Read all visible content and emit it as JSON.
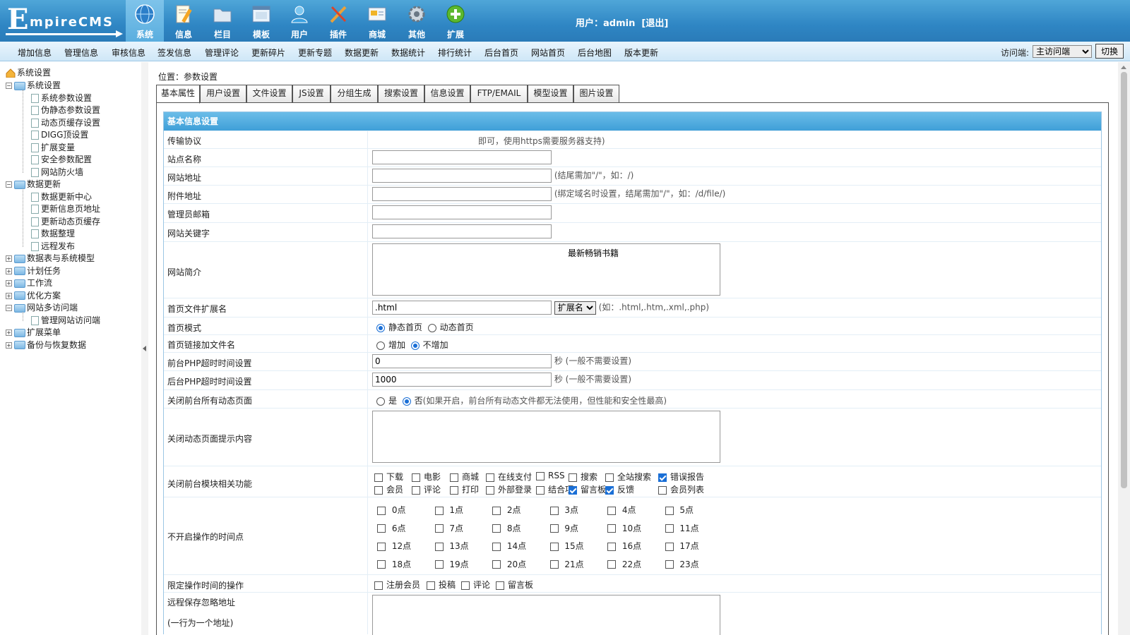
{
  "logo": {
    "first": "E",
    "rest": "mpireCMS"
  },
  "nav": [
    {
      "label": "系统",
      "icon": "globe-icon"
    },
    {
      "label": "信息",
      "icon": "document-edit-icon"
    },
    {
      "label": "栏目",
      "icon": "folder-icon"
    },
    {
      "label": "模板",
      "icon": "template-window-icon"
    },
    {
      "label": "用户",
      "icon": "user-icon"
    },
    {
      "label": "插件",
      "icon": "tools-icon"
    },
    {
      "label": "商城",
      "icon": "shop-icon"
    },
    {
      "label": "其他",
      "icon": "gear-icon"
    },
    {
      "label": "扩展",
      "icon": "plus-circle-icon"
    }
  ],
  "user": {
    "prefix": "用户：",
    "name": "admin",
    "logout": "[退出]"
  },
  "menu": [
    "增加信息",
    "管理信息",
    "审核信息",
    "签发信息",
    "管理评论",
    "更新碎片",
    "更新专题",
    "数据更新",
    "数据统计",
    "排行统计",
    "后台首页",
    "网站首页",
    "后台地图",
    "版本更新"
  ],
  "access": {
    "label": "访问端:",
    "selected": "主访问端",
    "switch_label": "切换"
  },
  "tree": {
    "root": "系统设置",
    "groups": [
      {
        "label": "系统设置",
        "items": [
          "系统参数设置",
          "伪静态参数设置",
          "动态页缓存设置",
          "DIGG顶设置",
          "扩展变量",
          "安全参数配置",
          "网站防火墙"
        ]
      },
      {
        "label": "数据更新",
        "items": [
          "数据更新中心",
          "更新信息页地址",
          "更新动态页缓存",
          "数据整理",
          "远程发布"
        ]
      },
      {
        "label": "数据表与系统模型",
        "items": []
      },
      {
        "label": "计划任务",
        "items": []
      },
      {
        "label": "工作流",
        "items": []
      },
      {
        "label": "优化方案",
        "items": []
      },
      {
        "label": "网站多访问端",
        "items": [
          "管理网站访问端"
        ]
      },
      {
        "label": "扩展菜单",
        "items": []
      },
      {
        "label": "备份与恢复数据",
        "items": []
      }
    ]
  },
  "breadcrumb": "位置：参数设置",
  "tabs": [
    "基本属性",
    "用户设置",
    "文件设置",
    "JS设置",
    "分组生成",
    "搜索设置",
    "信息设置",
    "FTP/EMAIL",
    "模型设置",
    "图片设置"
  ],
  "form": {
    "section_title": "基本信息设置",
    "protocol": {
      "label": "传输协议",
      "hint": "即可，使用https需要服务器支持)"
    },
    "site_name": {
      "label": "站点名称",
      "value": ""
    },
    "site_url": {
      "label": "网站地址",
      "value": "",
      "hint": "(结尾需加\"/\"，如：/)"
    },
    "attach_url": {
      "label": "附件地址",
      "value": "",
      "hint": "(绑定域名时设置，结尾需加\"/\"，如：/d/file/)"
    },
    "admin_email": {
      "label": "管理员邮箱",
      "value": ""
    },
    "keywords": {
      "label": "网站关键字",
      "value": ""
    },
    "intro": {
      "label": "网站简介",
      "value": "最新畅销书籍"
    },
    "index_ext": {
      "label": "首页文件扩展名",
      "value": ".html",
      "select": "扩展名",
      "hint": "(如：.html,.htm,.xml,.php)"
    },
    "index_mode": {
      "label": "首页模式",
      "opt1": "静态首页",
      "opt2": "动态首页"
    },
    "index_link": {
      "label": "首页链接加文件名",
      "opt1": "增加",
      "opt2": "不增加"
    },
    "front_timeout": {
      "label": "前台PHP超时时间设置",
      "value": "0",
      "hint": "秒 (一般不需要设置)"
    },
    "back_timeout": {
      "label": "后台PHP超时时间设置",
      "value": "1000",
      "hint": "秒 (一般不需要设置)"
    },
    "close_dynamic": {
      "label": "关闭前台所有动态页面",
      "opt1": "是",
      "opt2": "否",
      "hint": "(如果开启，前台所有动态文件都无法使用，但性能和安全性最高)"
    },
    "close_tip": {
      "label": "关闭动态页面提示内容",
      "value": ""
    },
    "close_modules": {
      "label": "关闭前台模块相关功能",
      "row1": [
        {
          "t": "下载",
          "on": false
        },
        {
          "t": "电影",
          "on": false
        },
        {
          "t": "商城",
          "on": false
        },
        {
          "t": "在线支付",
          "on": false
        },
        {
          "t": "RSS",
          "on": false
        },
        {
          "t": "搜索",
          "on": false
        },
        {
          "t": "全站搜索",
          "on": false
        },
        {
          "t": "错误报告",
          "on": true
        }
      ],
      "row2": [
        {
          "t": "会员",
          "on": false
        },
        {
          "t": "评论",
          "on": false
        },
        {
          "t": "打印",
          "on": false
        },
        {
          "t": "外部登录",
          "on": false
        },
        {
          "t": "结合项",
          "on": false
        },
        {
          "t": "留言板",
          "on": true
        },
        {
          "t": "反馈",
          "on": true
        },
        {
          "t": "会员列表",
          "on": false
        }
      ]
    },
    "hours": {
      "label": "不开启操作的时间点",
      "items": [
        "0点",
        "1点",
        "2点",
        "3点",
        "4点",
        "5点",
        "6点",
        "7点",
        "8点",
        "9点",
        "10点",
        "11点",
        "12点",
        "13点",
        "14点",
        "15点",
        "16点",
        "17点",
        "18点",
        "19点",
        "20点",
        "21点",
        "22点",
        "23点"
      ]
    },
    "limit_ops": {
      "label": "限定操作时间的操作",
      "items": [
        "注册会员",
        "投稿",
        "评论",
        "留言板"
      ]
    },
    "remote": {
      "label": "远程保存忽略地址",
      "sub": "(一行为一个地址)"
    }
  }
}
